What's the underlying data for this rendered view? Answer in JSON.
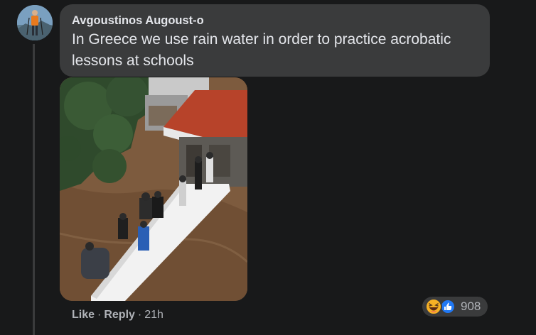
{
  "comment": {
    "author": "Avgoustinos Augoust-o",
    "text": "In Greece we use rain water in order to practice acrobatic lessons at schools"
  },
  "actions": {
    "like": "Like",
    "reply": "Reply",
    "time": "21h",
    "separator": "·"
  },
  "reactions": {
    "count": "908",
    "icons": [
      "haha-icon",
      "like-icon"
    ],
    "colors": {
      "haha": "#f7b125",
      "like": "#2078f4"
    }
  },
  "colors": {
    "background": "#18191a",
    "bubble": "#3a3b3c",
    "primary_text": "#e4e6eb",
    "secondary_text": "#b0b3b8"
  }
}
